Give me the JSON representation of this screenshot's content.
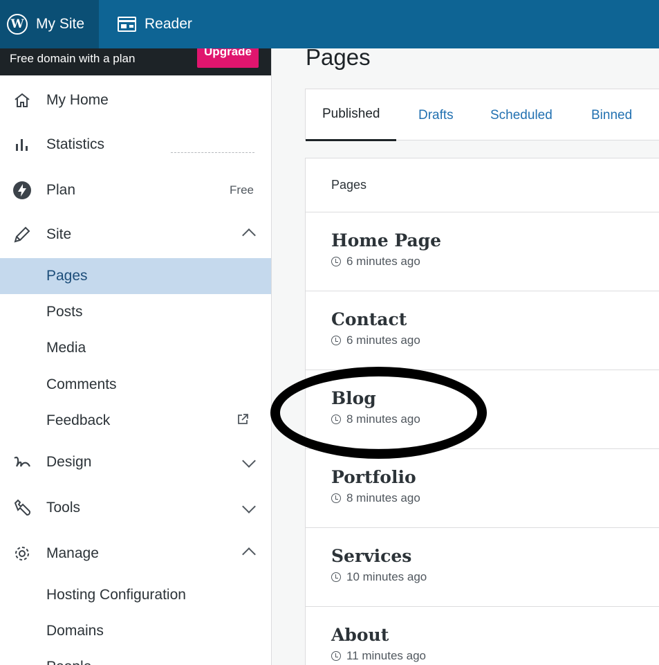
{
  "topbar": {
    "mysite_label": "My Site",
    "reader_label": "Reader",
    "colors": {
      "bar": "#0e6494",
      "mysite_bg": "#0b4f75"
    }
  },
  "promo": {
    "text": "Free domain with a plan",
    "button_label": "Upgrade",
    "button_color": "#e0156e"
  },
  "sidebar": {
    "items": [
      {
        "label": "My Home",
        "icon": "home-icon"
      },
      {
        "label": "Statistics",
        "icon": "bar-chart-icon"
      },
      {
        "label": "Plan",
        "icon": "plan-bolt-icon",
        "badge": "Free"
      },
      {
        "label": "Site",
        "icon": "pencil-icon",
        "expanded": true
      },
      {
        "label": "Design",
        "icon": "design-squiggle-icon",
        "expanded": false
      },
      {
        "label": "Tools",
        "icon": "wrench-icon",
        "expanded": false
      },
      {
        "label": "Manage",
        "icon": "gear-icon",
        "expanded": true
      }
    ],
    "site_sub": [
      "Pages",
      "Posts",
      "Media",
      "Comments",
      "Feedback"
    ],
    "manage_sub": [
      "Hosting Configuration",
      "Domains",
      "People"
    ],
    "active_color": "#c5d9ed"
  },
  "main": {
    "title": "Pages",
    "tabs": [
      "Published",
      "Drafts",
      "Scheduled",
      "Binned"
    ],
    "list_header": "Pages",
    "pages": [
      {
        "title": "Home Page",
        "time": "6 minutes ago"
      },
      {
        "title": "Contact",
        "time": "6 minutes ago"
      },
      {
        "title": "Blog",
        "time": "8 minutes ago"
      },
      {
        "title": "Portfolio",
        "time": "8 minutes ago"
      },
      {
        "title": "Services",
        "time": "10 minutes ago"
      },
      {
        "title": "About",
        "time": "11 minutes ago"
      }
    ]
  }
}
